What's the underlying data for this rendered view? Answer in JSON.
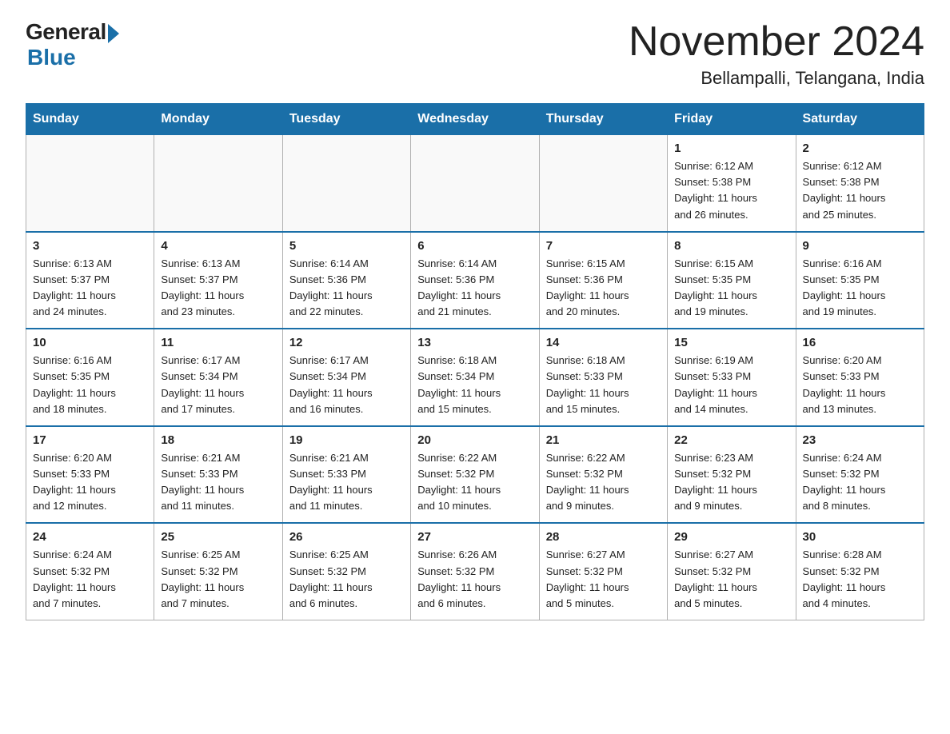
{
  "logo": {
    "general": "General",
    "blue": "Blue"
  },
  "title": {
    "month": "November 2024",
    "location": "Bellampalli, Telangana, India"
  },
  "weekdays": [
    "Sunday",
    "Monday",
    "Tuesday",
    "Wednesday",
    "Thursday",
    "Friday",
    "Saturday"
  ],
  "weeks": [
    [
      {
        "day": "",
        "info": ""
      },
      {
        "day": "",
        "info": ""
      },
      {
        "day": "",
        "info": ""
      },
      {
        "day": "",
        "info": ""
      },
      {
        "day": "",
        "info": ""
      },
      {
        "day": "1",
        "info": "Sunrise: 6:12 AM\nSunset: 5:38 PM\nDaylight: 11 hours\nand 26 minutes."
      },
      {
        "day": "2",
        "info": "Sunrise: 6:12 AM\nSunset: 5:38 PM\nDaylight: 11 hours\nand 25 minutes."
      }
    ],
    [
      {
        "day": "3",
        "info": "Sunrise: 6:13 AM\nSunset: 5:37 PM\nDaylight: 11 hours\nand 24 minutes."
      },
      {
        "day": "4",
        "info": "Sunrise: 6:13 AM\nSunset: 5:37 PM\nDaylight: 11 hours\nand 23 minutes."
      },
      {
        "day": "5",
        "info": "Sunrise: 6:14 AM\nSunset: 5:36 PM\nDaylight: 11 hours\nand 22 minutes."
      },
      {
        "day": "6",
        "info": "Sunrise: 6:14 AM\nSunset: 5:36 PM\nDaylight: 11 hours\nand 21 minutes."
      },
      {
        "day": "7",
        "info": "Sunrise: 6:15 AM\nSunset: 5:36 PM\nDaylight: 11 hours\nand 20 minutes."
      },
      {
        "day": "8",
        "info": "Sunrise: 6:15 AM\nSunset: 5:35 PM\nDaylight: 11 hours\nand 19 minutes."
      },
      {
        "day": "9",
        "info": "Sunrise: 6:16 AM\nSunset: 5:35 PM\nDaylight: 11 hours\nand 19 minutes."
      }
    ],
    [
      {
        "day": "10",
        "info": "Sunrise: 6:16 AM\nSunset: 5:35 PM\nDaylight: 11 hours\nand 18 minutes."
      },
      {
        "day": "11",
        "info": "Sunrise: 6:17 AM\nSunset: 5:34 PM\nDaylight: 11 hours\nand 17 minutes."
      },
      {
        "day": "12",
        "info": "Sunrise: 6:17 AM\nSunset: 5:34 PM\nDaylight: 11 hours\nand 16 minutes."
      },
      {
        "day": "13",
        "info": "Sunrise: 6:18 AM\nSunset: 5:34 PM\nDaylight: 11 hours\nand 15 minutes."
      },
      {
        "day": "14",
        "info": "Sunrise: 6:18 AM\nSunset: 5:33 PM\nDaylight: 11 hours\nand 15 minutes."
      },
      {
        "day": "15",
        "info": "Sunrise: 6:19 AM\nSunset: 5:33 PM\nDaylight: 11 hours\nand 14 minutes."
      },
      {
        "day": "16",
        "info": "Sunrise: 6:20 AM\nSunset: 5:33 PM\nDaylight: 11 hours\nand 13 minutes."
      }
    ],
    [
      {
        "day": "17",
        "info": "Sunrise: 6:20 AM\nSunset: 5:33 PM\nDaylight: 11 hours\nand 12 minutes."
      },
      {
        "day": "18",
        "info": "Sunrise: 6:21 AM\nSunset: 5:33 PM\nDaylight: 11 hours\nand 11 minutes."
      },
      {
        "day": "19",
        "info": "Sunrise: 6:21 AM\nSunset: 5:33 PM\nDaylight: 11 hours\nand 11 minutes."
      },
      {
        "day": "20",
        "info": "Sunrise: 6:22 AM\nSunset: 5:32 PM\nDaylight: 11 hours\nand 10 minutes."
      },
      {
        "day": "21",
        "info": "Sunrise: 6:22 AM\nSunset: 5:32 PM\nDaylight: 11 hours\nand 9 minutes."
      },
      {
        "day": "22",
        "info": "Sunrise: 6:23 AM\nSunset: 5:32 PM\nDaylight: 11 hours\nand 9 minutes."
      },
      {
        "day": "23",
        "info": "Sunrise: 6:24 AM\nSunset: 5:32 PM\nDaylight: 11 hours\nand 8 minutes."
      }
    ],
    [
      {
        "day": "24",
        "info": "Sunrise: 6:24 AM\nSunset: 5:32 PM\nDaylight: 11 hours\nand 7 minutes."
      },
      {
        "day": "25",
        "info": "Sunrise: 6:25 AM\nSunset: 5:32 PM\nDaylight: 11 hours\nand 7 minutes."
      },
      {
        "day": "26",
        "info": "Sunrise: 6:25 AM\nSunset: 5:32 PM\nDaylight: 11 hours\nand 6 minutes."
      },
      {
        "day": "27",
        "info": "Sunrise: 6:26 AM\nSunset: 5:32 PM\nDaylight: 11 hours\nand 6 minutes."
      },
      {
        "day": "28",
        "info": "Sunrise: 6:27 AM\nSunset: 5:32 PM\nDaylight: 11 hours\nand 5 minutes."
      },
      {
        "day": "29",
        "info": "Sunrise: 6:27 AM\nSunset: 5:32 PM\nDaylight: 11 hours\nand 5 minutes."
      },
      {
        "day": "30",
        "info": "Sunrise: 6:28 AM\nSunset: 5:32 PM\nDaylight: 11 hours\nand 4 minutes."
      }
    ]
  ]
}
